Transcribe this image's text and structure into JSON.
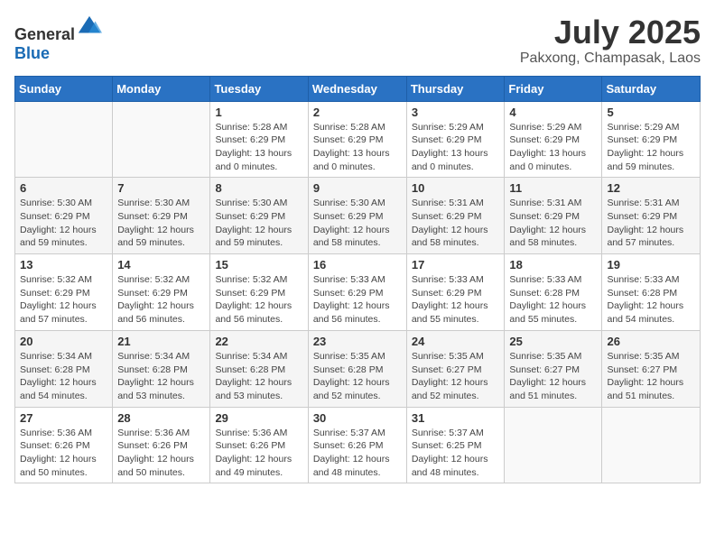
{
  "header": {
    "logo": {
      "text_general": "General",
      "text_blue": "Blue"
    },
    "title": "July 2025",
    "location": "Pakxong, Champasak, Laos"
  },
  "calendar": {
    "weekdays": [
      "Sunday",
      "Monday",
      "Tuesday",
      "Wednesday",
      "Thursday",
      "Friday",
      "Saturday"
    ],
    "weeks": [
      [
        {
          "day": "",
          "info": ""
        },
        {
          "day": "",
          "info": ""
        },
        {
          "day": "1",
          "info": "Sunrise: 5:28 AM\nSunset: 6:29 PM\nDaylight: 13 hours\nand 0 minutes."
        },
        {
          "day": "2",
          "info": "Sunrise: 5:28 AM\nSunset: 6:29 PM\nDaylight: 13 hours\nand 0 minutes."
        },
        {
          "day": "3",
          "info": "Sunrise: 5:29 AM\nSunset: 6:29 PM\nDaylight: 13 hours\nand 0 minutes."
        },
        {
          "day": "4",
          "info": "Sunrise: 5:29 AM\nSunset: 6:29 PM\nDaylight: 13 hours\nand 0 minutes."
        },
        {
          "day": "5",
          "info": "Sunrise: 5:29 AM\nSunset: 6:29 PM\nDaylight: 12 hours\nand 59 minutes."
        }
      ],
      [
        {
          "day": "6",
          "info": "Sunrise: 5:30 AM\nSunset: 6:29 PM\nDaylight: 12 hours\nand 59 minutes."
        },
        {
          "day": "7",
          "info": "Sunrise: 5:30 AM\nSunset: 6:29 PM\nDaylight: 12 hours\nand 59 minutes."
        },
        {
          "day": "8",
          "info": "Sunrise: 5:30 AM\nSunset: 6:29 PM\nDaylight: 12 hours\nand 59 minutes."
        },
        {
          "day": "9",
          "info": "Sunrise: 5:30 AM\nSunset: 6:29 PM\nDaylight: 12 hours\nand 58 minutes."
        },
        {
          "day": "10",
          "info": "Sunrise: 5:31 AM\nSunset: 6:29 PM\nDaylight: 12 hours\nand 58 minutes."
        },
        {
          "day": "11",
          "info": "Sunrise: 5:31 AM\nSunset: 6:29 PM\nDaylight: 12 hours\nand 58 minutes."
        },
        {
          "day": "12",
          "info": "Sunrise: 5:31 AM\nSunset: 6:29 PM\nDaylight: 12 hours\nand 57 minutes."
        }
      ],
      [
        {
          "day": "13",
          "info": "Sunrise: 5:32 AM\nSunset: 6:29 PM\nDaylight: 12 hours\nand 57 minutes."
        },
        {
          "day": "14",
          "info": "Sunrise: 5:32 AM\nSunset: 6:29 PM\nDaylight: 12 hours\nand 56 minutes."
        },
        {
          "day": "15",
          "info": "Sunrise: 5:32 AM\nSunset: 6:29 PM\nDaylight: 12 hours\nand 56 minutes."
        },
        {
          "day": "16",
          "info": "Sunrise: 5:33 AM\nSunset: 6:29 PM\nDaylight: 12 hours\nand 56 minutes."
        },
        {
          "day": "17",
          "info": "Sunrise: 5:33 AM\nSunset: 6:29 PM\nDaylight: 12 hours\nand 55 minutes."
        },
        {
          "day": "18",
          "info": "Sunrise: 5:33 AM\nSunset: 6:28 PM\nDaylight: 12 hours\nand 55 minutes."
        },
        {
          "day": "19",
          "info": "Sunrise: 5:33 AM\nSunset: 6:28 PM\nDaylight: 12 hours\nand 54 minutes."
        }
      ],
      [
        {
          "day": "20",
          "info": "Sunrise: 5:34 AM\nSunset: 6:28 PM\nDaylight: 12 hours\nand 54 minutes."
        },
        {
          "day": "21",
          "info": "Sunrise: 5:34 AM\nSunset: 6:28 PM\nDaylight: 12 hours\nand 53 minutes."
        },
        {
          "day": "22",
          "info": "Sunrise: 5:34 AM\nSunset: 6:28 PM\nDaylight: 12 hours\nand 53 minutes."
        },
        {
          "day": "23",
          "info": "Sunrise: 5:35 AM\nSunset: 6:28 PM\nDaylight: 12 hours\nand 52 minutes."
        },
        {
          "day": "24",
          "info": "Sunrise: 5:35 AM\nSunset: 6:27 PM\nDaylight: 12 hours\nand 52 minutes."
        },
        {
          "day": "25",
          "info": "Sunrise: 5:35 AM\nSunset: 6:27 PM\nDaylight: 12 hours\nand 51 minutes."
        },
        {
          "day": "26",
          "info": "Sunrise: 5:35 AM\nSunset: 6:27 PM\nDaylight: 12 hours\nand 51 minutes."
        }
      ],
      [
        {
          "day": "27",
          "info": "Sunrise: 5:36 AM\nSunset: 6:26 PM\nDaylight: 12 hours\nand 50 minutes."
        },
        {
          "day": "28",
          "info": "Sunrise: 5:36 AM\nSunset: 6:26 PM\nDaylight: 12 hours\nand 50 minutes."
        },
        {
          "day": "29",
          "info": "Sunrise: 5:36 AM\nSunset: 6:26 PM\nDaylight: 12 hours\nand 49 minutes."
        },
        {
          "day": "30",
          "info": "Sunrise: 5:37 AM\nSunset: 6:26 PM\nDaylight: 12 hours\nand 48 minutes."
        },
        {
          "day": "31",
          "info": "Sunrise: 5:37 AM\nSunset: 6:25 PM\nDaylight: 12 hours\nand 48 minutes."
        },
        {
          "day": "",
          "info": ""
        },
        {
          "day": "",
          "info": ""
        }
      ]
    ]
  }
}
